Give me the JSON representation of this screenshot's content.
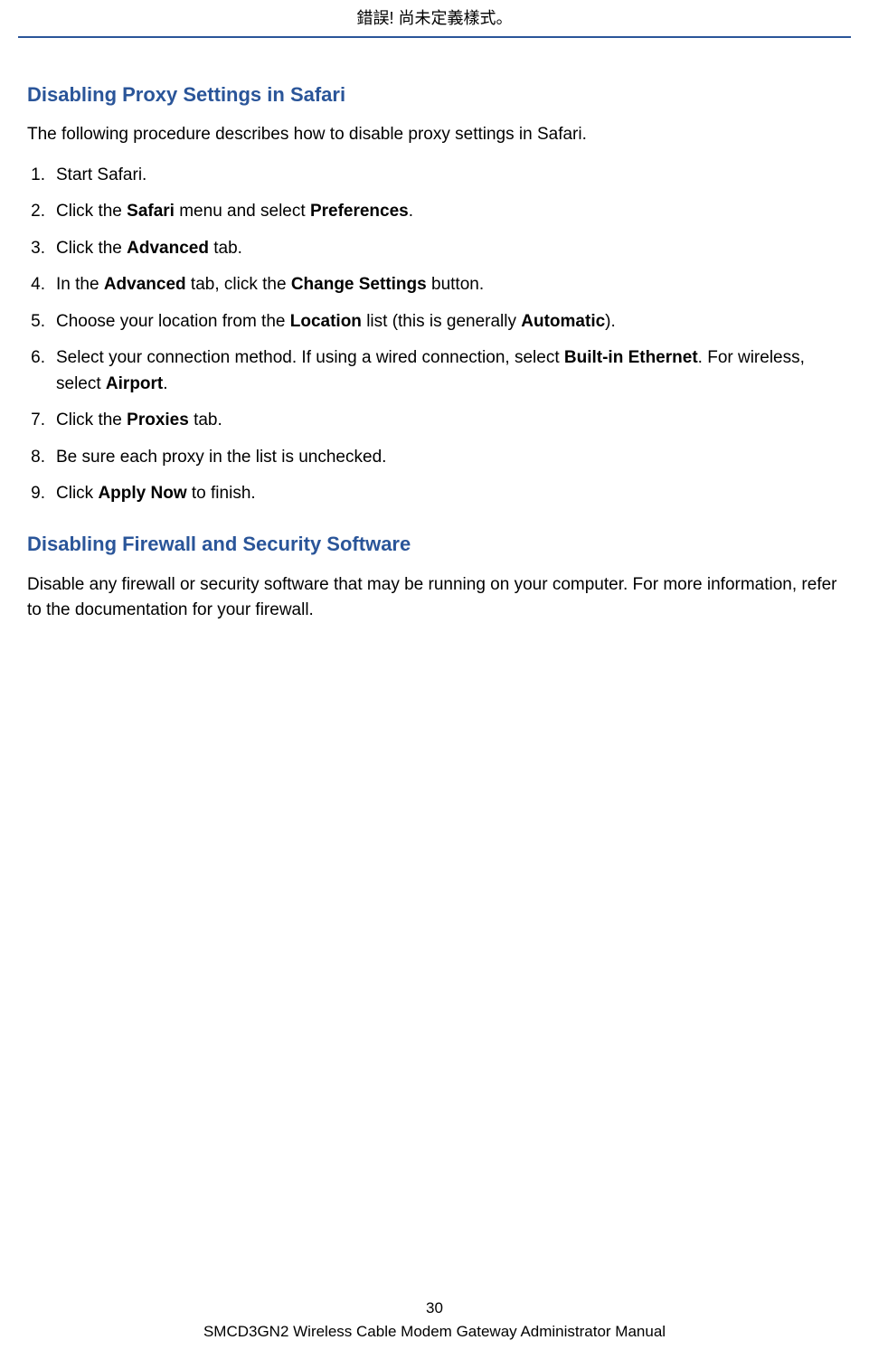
{
  "header": {
    "error_text": "錯誤! 尚未定義樣式。"
  },
  "section1": {
    "heading": "Disabling Proxy Settings in Safari",
    "intro": "The following procedure describes how to disable proxy settings in Safari.",
    "steps": {
      "s1": "Start Safari.",
      "s2_a": "Click the ",
      "s2_b": "Safari",
      "s2_c": " menu and select ",
      "s2_d": "Preferences",
      "s2_e": ".",
      "s3_a": "Click the ",
      "s3_b": "Advanced",
      "s3_c": " tab.",
      "s4_a": "In the ",
      "s4_b": "Advanced",
      "s4_c": " tab, click the ",
      "s4_d": "Change Settings",
      "s4_e": " button.",
      "s5_a": "Choose your location from the ",
      "s5_b": "Location",
      "s5_c": " list (this is generally ",
      "s5_d": "Automatic",
      "s5_e": ").",
      "s6_a": "Select your connection method. If using a wired connection, select ",
      "s6_b": "Built-in Ethernet",
      "s6_c": ". For wireless, select ",
      "s6_d": "Airport",
      "s6_e": ".",
      "s7_a": "Click the ",
      "s7_b": "Proxies",
      "s7_c": " tab.",
      "s8": "Be sure each proxy in the list is unchecked.",
      "s9_a": "Click ",
      "s9_b": "Apply Now",
      "s9_c": " to finish."
    }
  },
  "section2": {
    "heading": "Disabling Firewall and Security Software",
    "body": "Disable any firewall or security software that may be running on your computer. For more information, refer to the documentation for your firewall."
  },
  "footer": {
    "page_number": "30",
    "manual_title": "SMCD3GN2 Wireless Cable Modem Gateway Administrator Manual"
  }
}
